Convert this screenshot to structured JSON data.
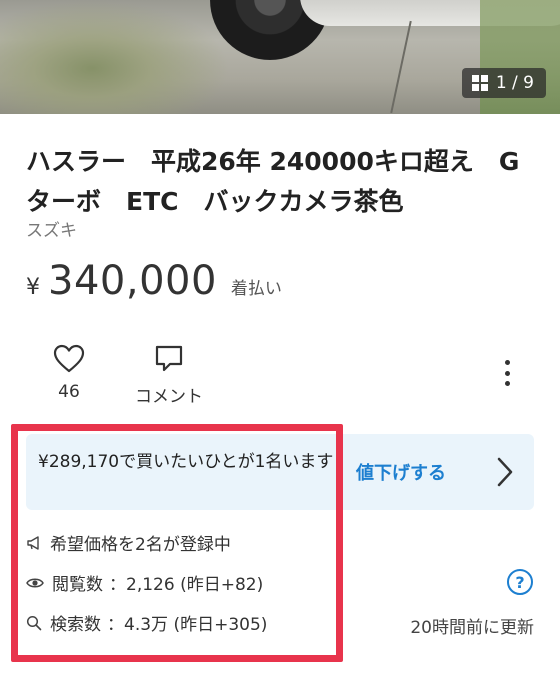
{
  "photo": {
    "counter": "1 / 9"
  },
  "listing": {
    "title": "ハスラー　平成26年 240000キロ超え　G　ターボ　ETC　バックカメラ茶色",
    "brand": "スズキ",
    "currency": "¥",
    "price": "340,000",
    "shipping": "着払い"
  },
  "actions": {
    "like_count": "46",
    "comment_label": "コメント"
  },
  "offer": {
    "text": "¥289,170で買いたいひとが1名います",
    "button_label": "値下げする"
  },
  "stats": {
    "wish_price": "希望価格を2名が登録中",
    "views_label": "閲覧数",
    "views_value": "：2,126 (昨日+82)",
    "search_label": "検索数",
    "search_value": "：4.3万 (昨日+305)",
    "help": "?",
    "updated": "20時間前に更新"
  },
  "colors": {
    "accent_blue": "#1d7fd0",
    "offer_bg": "#eaf4fb",
    "highlight_red": "#e8344c"
  }
}
